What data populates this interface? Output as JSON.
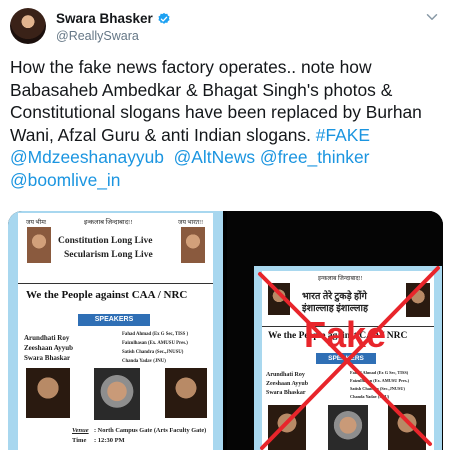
{
  "header": {
    "display_name": "Swara Bhasker",
    "handle": "@ReallySwara"
  },
  "tweet": {
    "text_plain": "How the fake news factory operates.. note how Babasaheb Ambedkar & Bhagat Singh's photos & Constitutional slogans have been replaced by Burhan Wani, Afzal Guru & anti Indian slogans. ",
    "hashtag": "#FAKE",
    "mentions": [
      "@Mdzeeshanayyub",
      "@AltNews",
      "@free_thinker",
      "@boomlive_in"
    ]
  },
  "original_poster": {
    "jai_bhim": "जय भीम!",
    "inquilab": "इन्कलाब जिन्दाबाद!!",
    "jai_bharat": "जय भारत!!",
    "slogan_line1": "Constitution Long Live",
    "slogan_line2": "Secularism Long Live",
    "headline": "We the People against CAA / NRC",
    "speakers_label": "SPEAKERS",
    "speakers_left": [
      "Arundhati Roy",
      "Zeeshaan Ayyub",
      "Swara Bhaskar"
    ],
    "speakers_right": [
      "Fahad Ahmad (Ex G Sec, TISS )",
      "Faizulhasan (Ex. AMUSU Pres.)",
      "Satish Chandra (Sec.,JNUSU)",
      "Chanda Yadav (JNU)"
    ],
    "venue_label": "Venue",
    "venue_value": ": North Campus Gate (Arts Faculty Gate)",
    "time_label": "Time",
    "time_value": ": 12:30 PM"
  },
  "fake_poster": {
    "inquilab": "इन्कलाब जिन्दाबाद!!",
    "slogan_line1": "भारत तेरे टुकड़े होंगे",
    "slogan_line2": "इंशाल्लाह इंशाल्लाह",
    "headline": "We the People against CAA / NRC",
    "speakers_label": "SPEAKERS",
    "speakers_left": [
      "Arundhati Roy",
      "Zeeshaan Ayyub",
      "Swara Bhaskar"
    ],
    "speakers_right": [
      "Fahad Ahmad (Ex G Sec, TISS)",
      "Faizulhasan (Ex. AMUSU Pres.)",
      "Satish Chandra (Sec.,JNUSU)",
      "Chanda Yadav (JNU)"
    ],
    "stamp": "Fake"
  },
  "colors": {
    "link": "#1b95e0",
    "verified": "#1da1f2",
    "handle_gray": "#657786",
    "fake_red": "#e8252b",
    "poster_bg": "#a8d7ef"
  },
  "icons": [
    "verified-badge-icon",
    "chevron-down-icon"
  ]
}
